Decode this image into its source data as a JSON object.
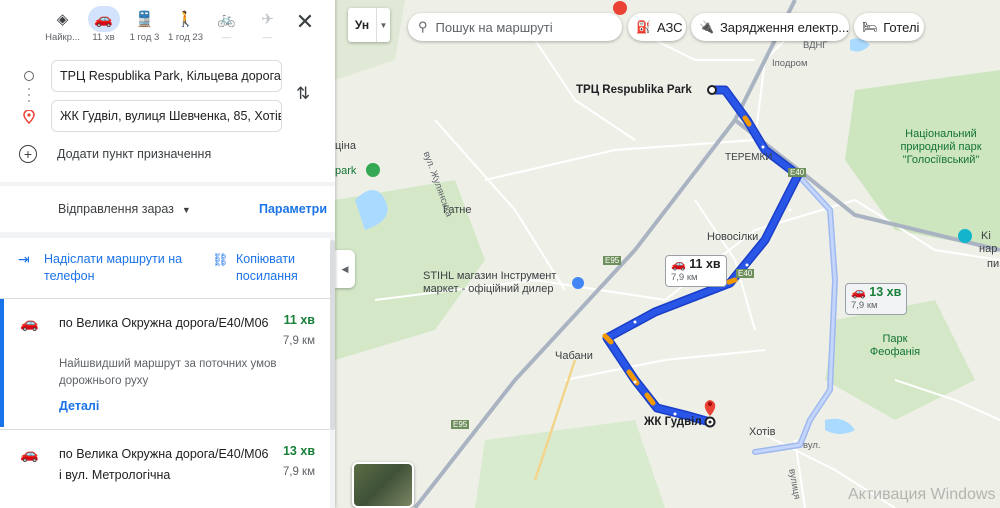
{
  "sidebar": {
    "modes": [
      {
        "label": "Найкр...",
        "icon": "best-route-icon",
        "glyph": "◈"
      },
      {
        "label": "11 хв",
        "icon": "car-icon",
        "glyph": "🚗"
      },
      {
        "label": "1 год 3",
        "icon": "transit-icon",
        "glyph": "🚆"
      },
      {
        "label": "1 год 23",
        "icon": "walk-icon",
        "glyph": "🚶"
      },
      {
        "label": "—",
        "icon": "bicycle-icon",
        "glyph": "🚲"
      },
      {
        "label": "—",
        "icon": "plane-icon",
        "glyph": "✈"
      }
    ],
    "close_glyph": "✕",
    "origin": "ТРЦ Respublika Park, Кільцева дорога,",
    "destination": "ЖК Гудвіл, вулиця Шевченка, 85, Хотів",
    "add_destination": "Додати пункт призначення",
    "depart_now": "Відправлення зараз",
    "params": "Параметри",
    "send_to_phone": "Надіслати маршрути на телефон",
    "copy_link": "Копіювати посилання",
    "routes": [
      {
        "name": "по Велика Окружна дорога/E40/М06",
        "time": "11 хв",
        "distance": "7,9 км",
        "description": "Найшвидший маршрут за поточних умов дорожнього руху",
        "details": "Деталі"
      },
      {
        "name": "по Велика Окружна дорога/E40/М06 і вул. Метрологічна",
        "time": "13 хв",
        "distance": "7,9 км"
      }
    ]
  },
  "map": {
    "layer_button": "Ун",
    "search_placeholder": "Пошук на маршруті",
    "chips": [
      {
        "label": "АЗС",
        "icon": "gas-station-icon",
        "glyph": "⛽"
      },
      {
        "label": "Зарядження електр...",
        "icon": "ev-charger-icon",
        "glyph": "🔌"
      },
      {
        "label": "Готелі",
        "icon": "hotel-icon",
        "glyph": "🛏"
      }
    ],
    "labels": {
      "origin": "ТРЦ Respublika Park",
      "destination": "ЖК Гудвіл",
      "teremky": "ТЕРЕМКИ",
      "gatne": "Гатне",
      "novosilky": "Новосілки",
      "chabany": "Чабани",
      "khotiv": "Хотів",
      "park_national": "Національний природний парк \"Голосіївський\"",
      "park_feofania": "Парк Феофанія",
      "stihl": "STIHL магазин Інструмент маркет - офіційний дилер",
      "vdng": "ВДНГ",
      "ipodrom": "Іподром",
      "park_left": "park",
      "tsina": "ціна",
      "street_zhuliany": "вул. Жулянська",
      "e95_a": "E95",
      "e95_b": "E95",
      "e40_a": "E40",
      "e40_b": "E40",
      "right_cut_1": "Ki",
      "right_cut_2": "нар",
      "right_cut_3": "пи",
      "bottom_street": "вулиця",
      "right_cut_vul": "вул."
    },
    "time_main": {
      "time": "11 хв",
      "distance": "7,9 км"
    },
    "time_alt": {
      "time": "13 хв",
      "distance": "7,9 км"
    },
    "watermark": "Активация Windows"
  }
}
